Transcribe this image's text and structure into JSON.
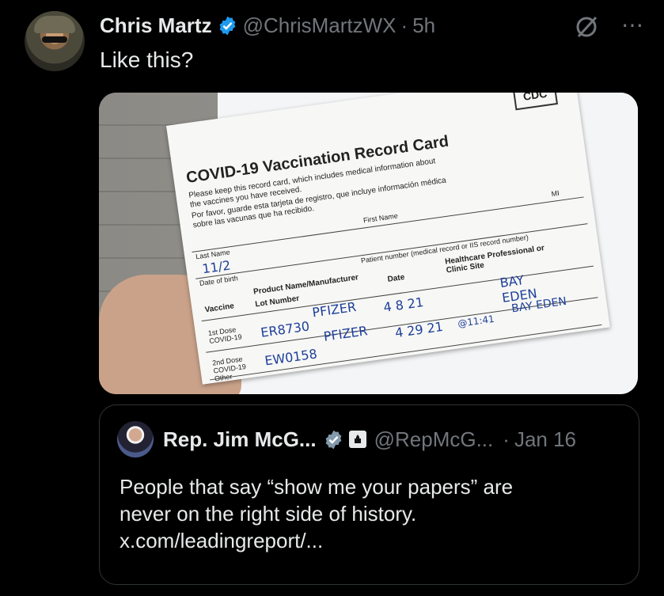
{
  "tweet": {
    "author_name": "Chris Martz",
    "author_handle": "@ChrisMartzWX",
    "separator": "·",
    "time": "5h",
    "text": "Like this?",
    "more_label": "⋯"
  },
  "media": {
    "card_title": "COVID-19 Vaccination Record Card",
    "line1": "Please keep this record card, which includes medical information about the vaccines you have received.",
    "line2": "Por favor, guarde esta tarjeta de registro, que incluye información médica sobre las vacunas que ha recibido.",
    "cdc": "CDC",
    "last_name": "Last Name",
    "first_name": "First Name",
    "mi": "MI",
    "dob": "Date of birth",
    "patient_number": "Patient number (medical record or IIS record number)",
    "vaccine": "Vaccine",
    "product": "Product Name/Manufacturer",
    "lot": "Lot Number",
    "date": "Date",
    "hcp": "Healthcare Professional or Clinic Site",
    "dose1": "1st Dose COVID-19",
    "dose2": "2nd Dose COVID-19",
    "other": "Other",
    "hw_dob": "11/2",
    "hw_pfizer1": "PFIZER",
    "hw_lot1": "ER8730",
    "hw_date1": "4 8 21",
    "hw_site1": "BAY EDEN",
    "hw_pfizer2": "PFIZER",
    "hw_lot2": "EW0158",
    "hw_date2": "4 29 21",
    "hw_time2": "@11:41",
    "hw_site2": "BAY EDEN"
  },
  "quote": {
    "author_name": "Rep. Jim McG...",
    "author_handle": "@RepMcG...",
    "separator": "·",
    "time": "Jan 16",
    "text_lines": [
      "People that say “show me your papers” are",
      "never on the right side of history.",
      "x.com/leadingreport/..."
    ]
  },
  "colors": {
    "background": "#000000",
    "text_primary": "#e7e9ea",
    "text_secondary": "#71767b",
    "verified_blue": "#1d9bf0",
    "border": "#2f3336"
  }
}
